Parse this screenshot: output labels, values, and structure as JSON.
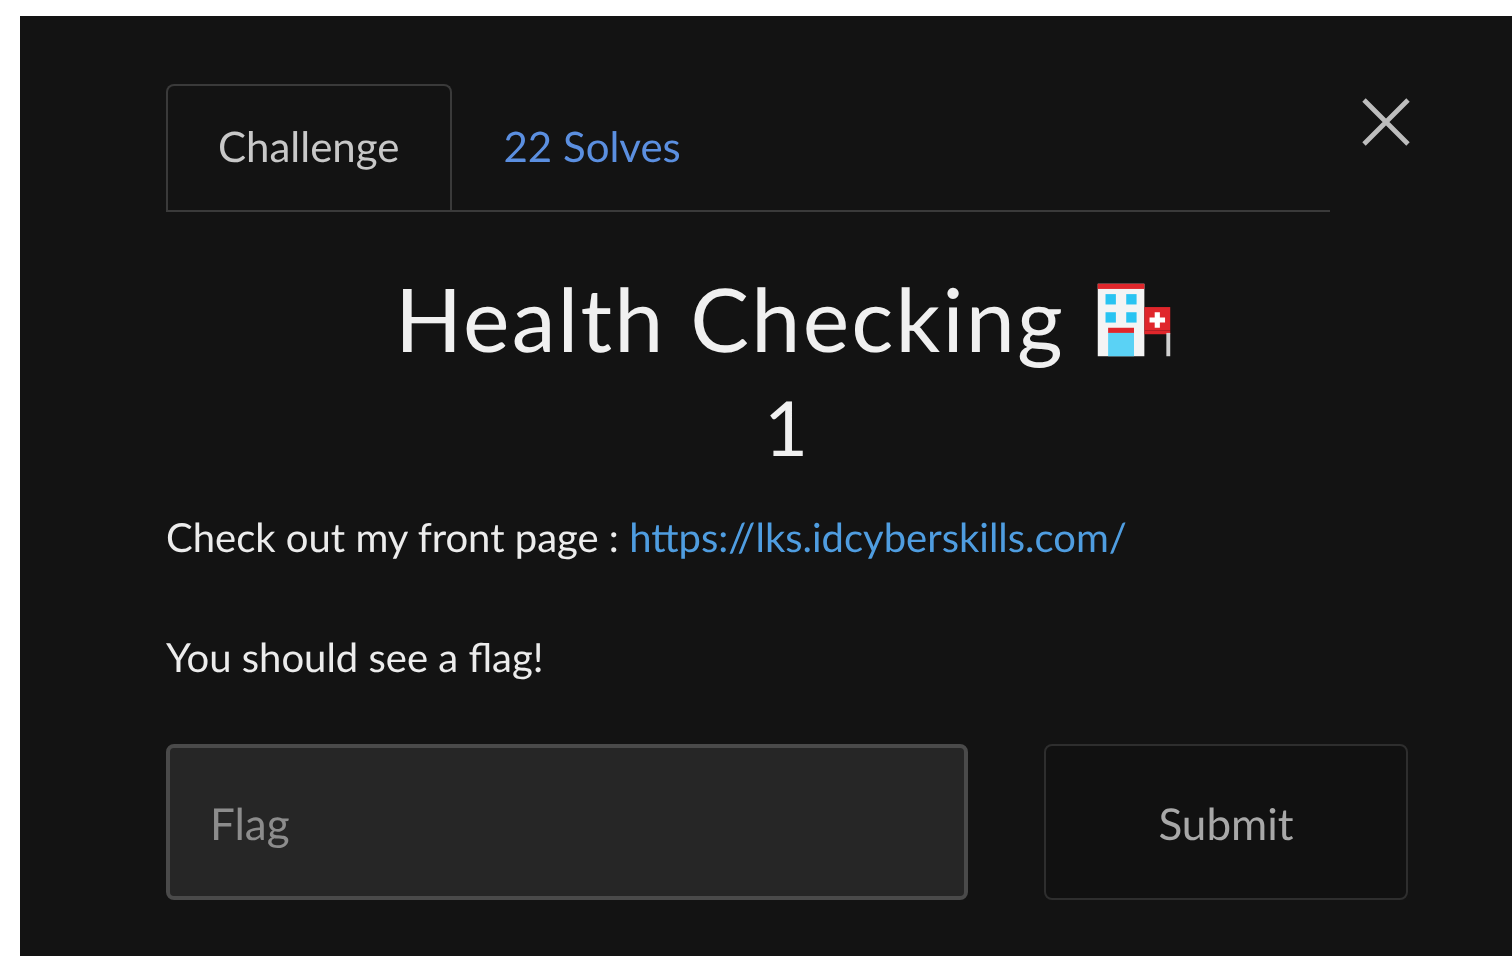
{
  "tabs": [
    {
      "label": "Challenge",
      "selected": true
    },
    {
      "label": "22 Solves",
      "selected": false
    }
  ],
  "title": "Health Checking",
  "value": "1",
  "description": [
    {
      "text": "Check out my front page : ",
      "link": "https://lks.idcyberskills.com/"
    },
    {
      "text": "You should see a flag!"
    }
  ],
  "flag_field": {
    "placeholder": "Flag"
  },
  "submit_button": "Submit"
}
